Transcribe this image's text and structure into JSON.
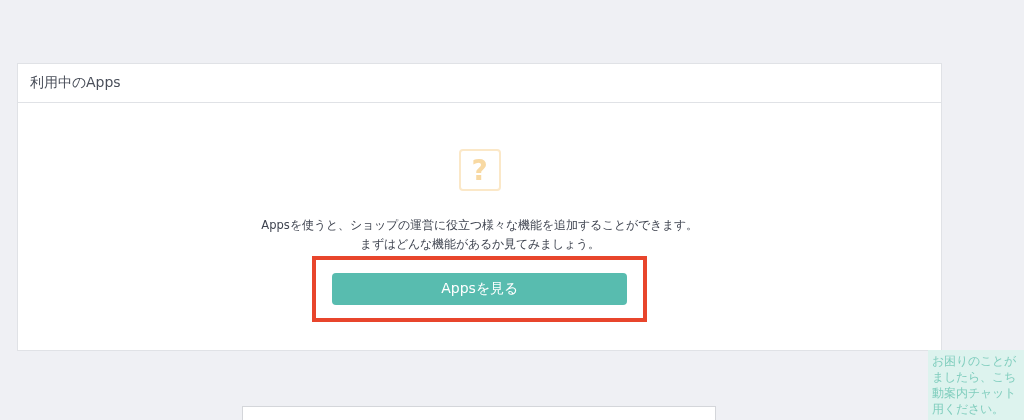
{
  "panel": {
    "title": "利用中のApps",
    "empty_state": {
      "icon": "?",
      "lines": [
        "Appsを使うと、ショップの運営に役立つ様々な機能を追加することができます。",
        "まずはどんな機能があるか見てみましょう。"
      ],
      "button": {
        "label": "Appsを見る",
        "highlighted": true
      }
    }
  },
  "chat_bubble": {
    "lines": [
      "お困りのことが",
      "ましたら、こち",
      "動案内チャット",
      "用ください。"
    ]
  }
}
